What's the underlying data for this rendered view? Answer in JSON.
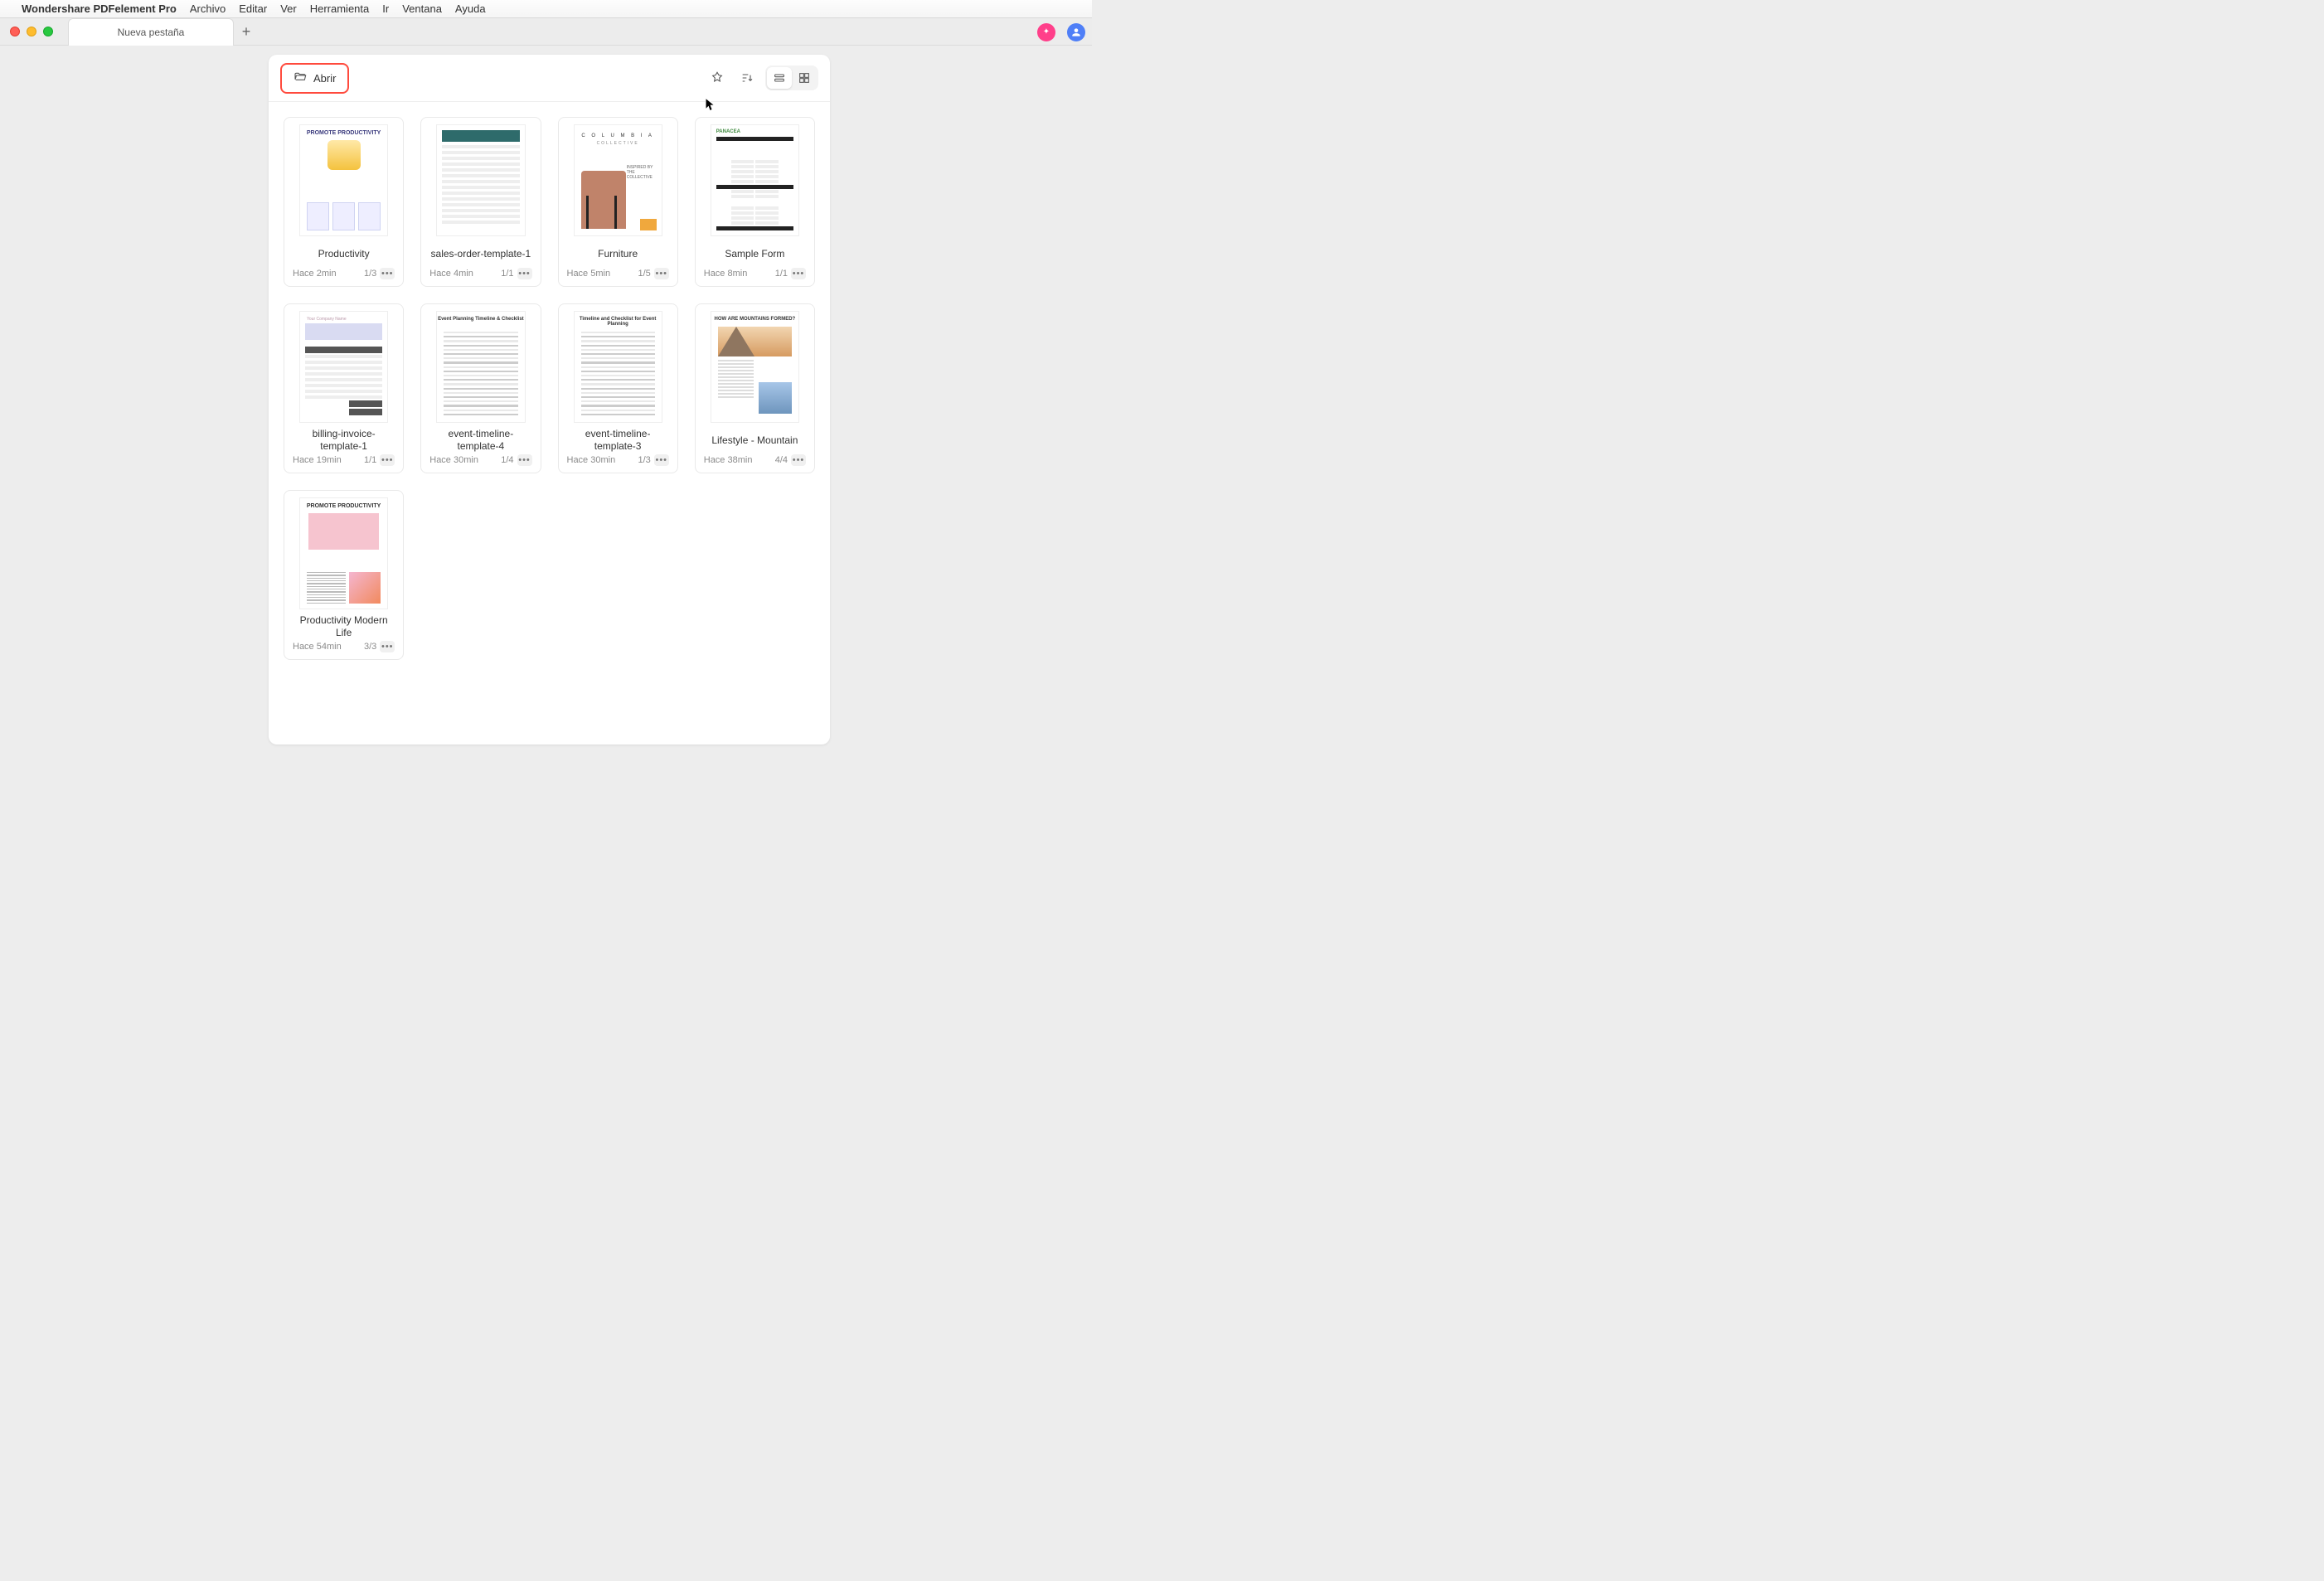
{
  "menubar": {
    "app_name": "Wondershare PDFelement Pro",
    "items": [
      "Archivo",
      "Editar",
      "Ver",
      "Herramienta",
      "Ir",
      "Ventana",
      "Ayuda"
    ]
  },
  "tabstrip": {
    "tab_label": "Nueva pestaña"
  },
  "panel": {
    "open_label": "Abrir"
  },
  "documents": [
    {
      "title": "Productivity",
      "time": "Hace 2min",
      "pages": "1/3",
      "thumb": "prod"
    },
    {
      "title": "sales-order-template-1",
      "time": "Hace 4min",
      "pages": "1/1",
      "thumb": "sales"
    },
    {
      "title": "Furniture",
      "time": "Hace 5min",
      "pages": "1/5",
      "thumb": "furn"
    },
    {
      "title": "Sample Form",
      "time": "Hace 8min",
      "pages": "1/1",
      "thumb": "form"
    },
    {
      "title": "billing-invoice-template-1",
      "time": "Hace 19min",
      "pages": "1/1",
      "thumb": "inv"
    },
    {
      "title": "event-timeline-template-4",
      "time": "Hace 30min",
      "pages": "1/4",
      "thumb": "check"
    },
    {
      "title": "event-timeline-template-3",
      "time": "Hace 30min",
      "pages": "1/3",
      "thumb": "check"
    },
    {
      "title": "Lifestyle - Mountain",
      "time": "Hace 38min",
      "pages": "4/4",
      "thumb": "mountain"
    },
    {
      "title": "Productivity Modern Life",
      "time": "Hace 54min",
      "pages": "3/3",
      "thumb": "prod2"
    }
  ],
  "thumb_text": {
    "prod_title": "PROMOTE PRODUCTIVITY",
    "furn_name": "C O L U M B I A",
    "furn_sub": "COLLECTIVE",
    "furn_side": "INSPIRED BY THE COLLECTIVE",
    "form_brand": "PANACEA",
    "inv_company": "Your Company Name",
    "check_title": "Event Planning Timeline & Checklist",
    "check_title2": "Timeline and Checklist for Event Planning",
    "mountain_q": "HOW ARE MOUNTAINS FORMED?",
    "prod2_title": "PROMOTE PRODUCTIVITY"
  }
}
